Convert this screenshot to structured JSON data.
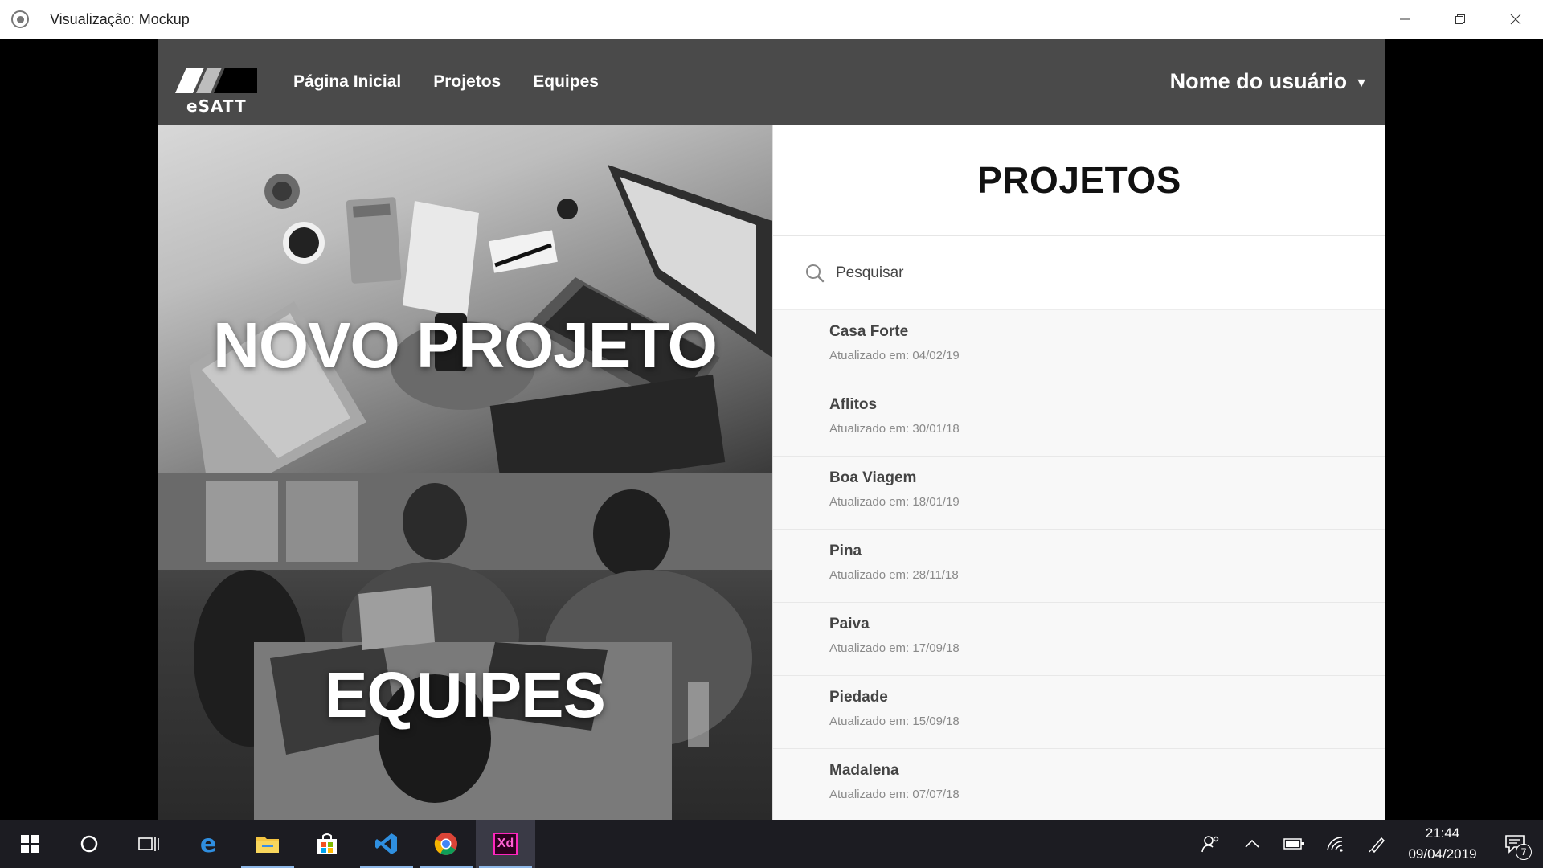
{
  "window": {
    "title": "Visualização: Mockup"
  },
  "navbar": {
    "logo_text": "eSATT",
    "links": [
      "Página Inicial",
      "Projetos",
      "Equipes"
    ],
    "user_name": "Nome do usuário"
  },
  "panels": {
    "new_project": "NOVO PROJETO",
    "teams": "EQUIPES"
  },
  "projects": {
    "title": "PROJETOS",
    "search_placeholder": "Pesquisar",
    "items": [
      {
        "name": "Casa Forte",
        "updated": "Atualizado em: 04/02/19"
      },
      {
        "name": "Aflitos",
        "updated": "Atualizado em: 30/01/18"
      },
      {
        "name": "Boa Viagem",
        "updated": "Atualizado em: 18/01/19"
      },
      {
        "name": "Pina",
        "updated": "Atualizado em: 28/11/18"
      },
      {
        "name": "Paiva",
        "updated": "Atualizado em: 17/09/18"
      },
      {
        "name": "Piedade",
        "updated": "Atualizado em: 15/09/18"
      },
      {
        "name": "Madalena",
        "updated": "Atualizado em: 07/07/18"
      }
    ]
  },
  "taskbar": {
    "apps": [
      "start-icon",
      "cortana-icon",
      "task-view-icon",
      "edge-icon",
      "file-explorer-icon",
      "store-icon",
      "vscode-icon",
      "chrome-icon",
      "xd-icon"
    ],
    "xd_label": "Xd",
    "time": "21:44",
    "date": "09/04/2019",
    "notification_count": "7"
  },
  "colors": {
    "navbar": "#4a4a4a",
    "taskbar": "#1c1c22",
    "xd_brand": "#ff26be"
  }
}
